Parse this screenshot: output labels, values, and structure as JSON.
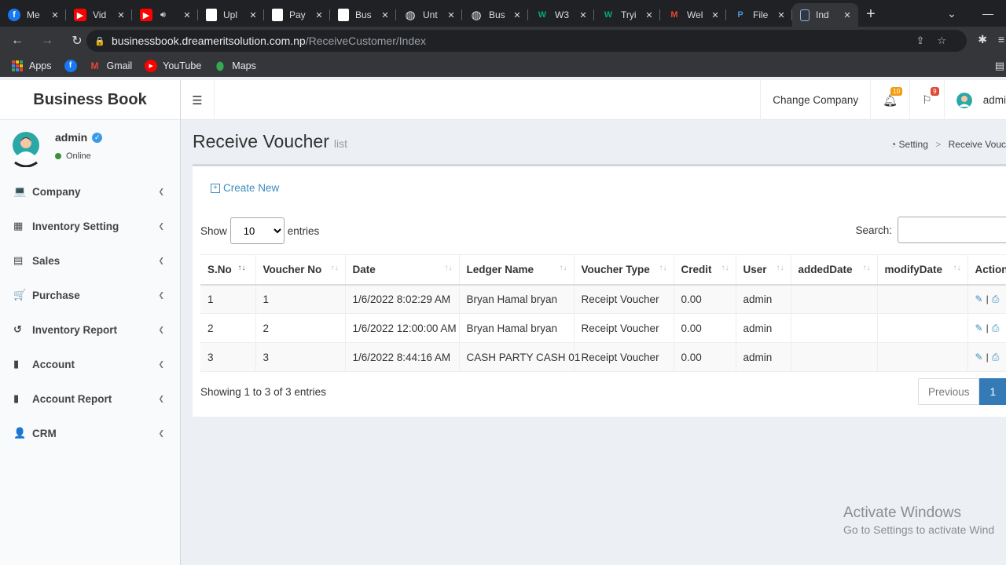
{
  "browser": {
    "tabs": [
      {
        "title": "Me",
        "icon": "facebook-icon",
        "color": "#1877f2",
        "glyph": "f",
        "active": false
      },
      {
        "title": "Vid",
        "icon": "youtube-icon",
        "color": "#ff0000",
        "glyph": "▶",
        "active": false
      },
      {
        "title": "",
        "icon": "youtube-icon",
        "color": "#ff0000",
        "glyph": "▶",
        "active": false,
        "audio": true
      },
      {
        "title": "Upl",
        "icon": "document-icon",
        "color": "#ffffff",
        "glyph": "",
        "active": false
      },
      {
        "title": "Pay",
        "icon": "document-icon",
        "color": "#ffffff",
        "glyph": "",
        "active": false
      },
      {
        "title": "Bus",
        "icon": "document-icon",
        "color": "#ffffff",
        "glyph": "",
        "active": false
      },
      {
        "title": "Unt",
        "icon": "globe-icon",
        "color": "#e8eaed",
        "glyph": "◍",
        "active": false
      },
      {
        "title": "Bus",
        "icon": "globe-icon",
        "color": "#e8eaed",
        "glyph": "◍",
        "active": false
      },
      {
        "title": "W3",
        "icon": "w3schools-icon",
        "color": "#04aa6d",
        "glyph": "W",
        "active": false
      },
      {
        "title": "Tryi",
        "icon": "w3schools-icon",
        "color": "#04aa6d",
        "glyph": "W",
        "active": false
      },
      {
        "title": "Wel",
        "icon": "gmail-icon",
        "color": "#ea4335",
        "glyph": "M",
        "active": false
      },
      {
        "title": "File",
        "icon": "p-icon",
        "color": "#4a90d9",
        "glyph": "P",
        "active": false
      },
      {
        "title": "Ind",
        "icon": "page-icon",
        "color": "#8ab4f8",
        "glyph": "",
        "active": true
      }
    ],
    "url_host": "businessbook.dreameritsolution.com.np",
    "url_path": "/ReceiveCustomer/Index",
    "bookmarks": [
      {
        "label": "Apps",
        "icon": "apps-grid-icon"
      },
      {
        "label": "",
        "icon": "facebook-icon"
      },
      {
        "label": "Gmail",
        "icon": "gmail-icon"
      },
      {
        "label": "YouTube",
        "icon": "youtube-icon"
      },
      {
        "label": "Maps",
        "icon": "maps-pin-icon"
      }
    ]
  },
  "app": {
    "brand": "Business Book",
    "user": {
      "name": "admin",
      "status": "Online"
    },
    "menu": [
      {
        "label": "Company",
        "icon": "laptop-icon",
        "glyph": "💻"
      },
      {
        "label": "Inventory Setting",
        "icon": "grid-icon",
        "glyph": "▦"
      },
      {
        "label": "Sales",
        "icon": "file-invoice-icon",
        "glyph": "▤"
      },
      {
        "label": "Purchase",
        "icon": "cart-icon",
        "glyph": "🛒"
      },
      {
        "label": "Inventory Report",
        "icon": "history-icon",
        "glyph": "↺"
      },
      {
        "label": "Account",
        "icon": "book-icon",
        "glyph": "▮"
      },
      {
        "label": "Account Report",
        "icon": "ledger-icon",
        "glyph": "▮"
      },
      {
        "label": "CRM",
        "icon": "user-plus-icon",
        "glyph": "👤"
      }
    ],
    "topbar": {
      "change_company": "Change Company",
      "notif_count": "10",
      "flag_count": "9",
      "user_label": "admi"
    },
    "page": {
      "title": "Receive Voucher",
      "subtitle": "list",
      "breadcrumb": [
        "Setting",
        "Receive Vouc"
      ],
      "create_new": "Create New",
      "show_label": "Show",
      "entries_label": "entries",
      "page_size": "10",
      "search_label": "Search:",
      "search_value": "",
      "columns": [
        "S.No",
        "Voucher No",
        "Date",
        "Ledger Name",
        "Voucher Type",
        "Credit",
        "User",
        "addedDate",
        "modifyDate",
        "Action"
      ],
      "rows": [
        [
          "1",
          "1",
          "1/6/2022 8:02:29 AM",
          "Bryan Hamal bryan",
          "Receipt Voucher",
          "0.00",
          "admin",
          "",
          ""
        ],
        [
          "2",
          "2",
          "1/6/2022 12:00:00 AM",
          "Bryan Hamal bryan",
          "Receipt Voucher",
          "0.00",
          "admin",
          "",
          ""
        ],
        [
          "3",
          "3",
          "1/6/2022 8:44:16 AM",
          "CASH PARTY CASH 01",
          "Receipt Voucher",
          "0.00",
          "admin",
          "",
          ""
        ]
      ],
      "info": "Showing 1 to 3 of 3 entries",
      "pager": {
        "previous": "Previous",
        "current": "1"
      }
    }
  },
  "watermark": {
    "line1": "Activate Windows",
    "line2": "Go to Settings to activate Wind"
  },
  "colors": {
    "link": "#3c8dbc",
    "pager_active": "#337ab7",
    "online": "#3c8d3c",
    "badge_warn": "#f39c12",
    "badge_danger": "#dd4b39"
  }
}
